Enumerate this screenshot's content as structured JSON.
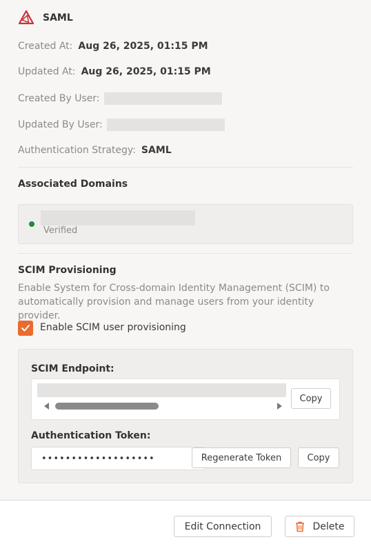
{
  "header": {
    "title": "SAML",
    "logo_icon": "saml-triangle-logo-icon"
  },
  "details": {
    "created_at_label": "Created At:",
    "created_at_value": "Aug 26, 2025, 01:15 PM",
    "updated_at_label": "Updated At:",
    "updated_at_value": "Aug 26, 2025, 01:15 PM",
    "created_by_label": "Created By User:",
    "updated_by_label": "Updated By User:",
    "auth_strategy_label": "Authentication Strategy:",
    "auth_strategy_value": "SAML"
  },
  "domains": {
    "title": "Associated Domains",
    "items": [
      {
        "status": "Verified",
        "status_color": "#1e8a3a"
      }
    ]
  },
  "scim": {
    "title": "SCIM Provisioning",
    "description": "Enable System for Cross-domain Identity Management (SCIM) to automatically provision and manage users from your identity provider.",
    "enable_label": "Enable SCIM user provisioning",
    "enabled": true,
    "endpoint_label": "SCIM Endpoint:",
    "copy_label": "Copy",
    "token_label": "Authentication Token:",
    "token_value": "•••••••••••••••••••",
    "regenerate_label": "Regenerate Token",
    "token_copy_label": "Copy"
  },
  "footer": {
    "edit_label": "Edit Connection",
    "delete_label": "Delete",
    "delete_icon": "trash-icon"
  },
  "colors": {
    "accent": "#e96b2e",
    "logo": "#c8323b",
    "verified": "#1e8a3a"
  }
}
